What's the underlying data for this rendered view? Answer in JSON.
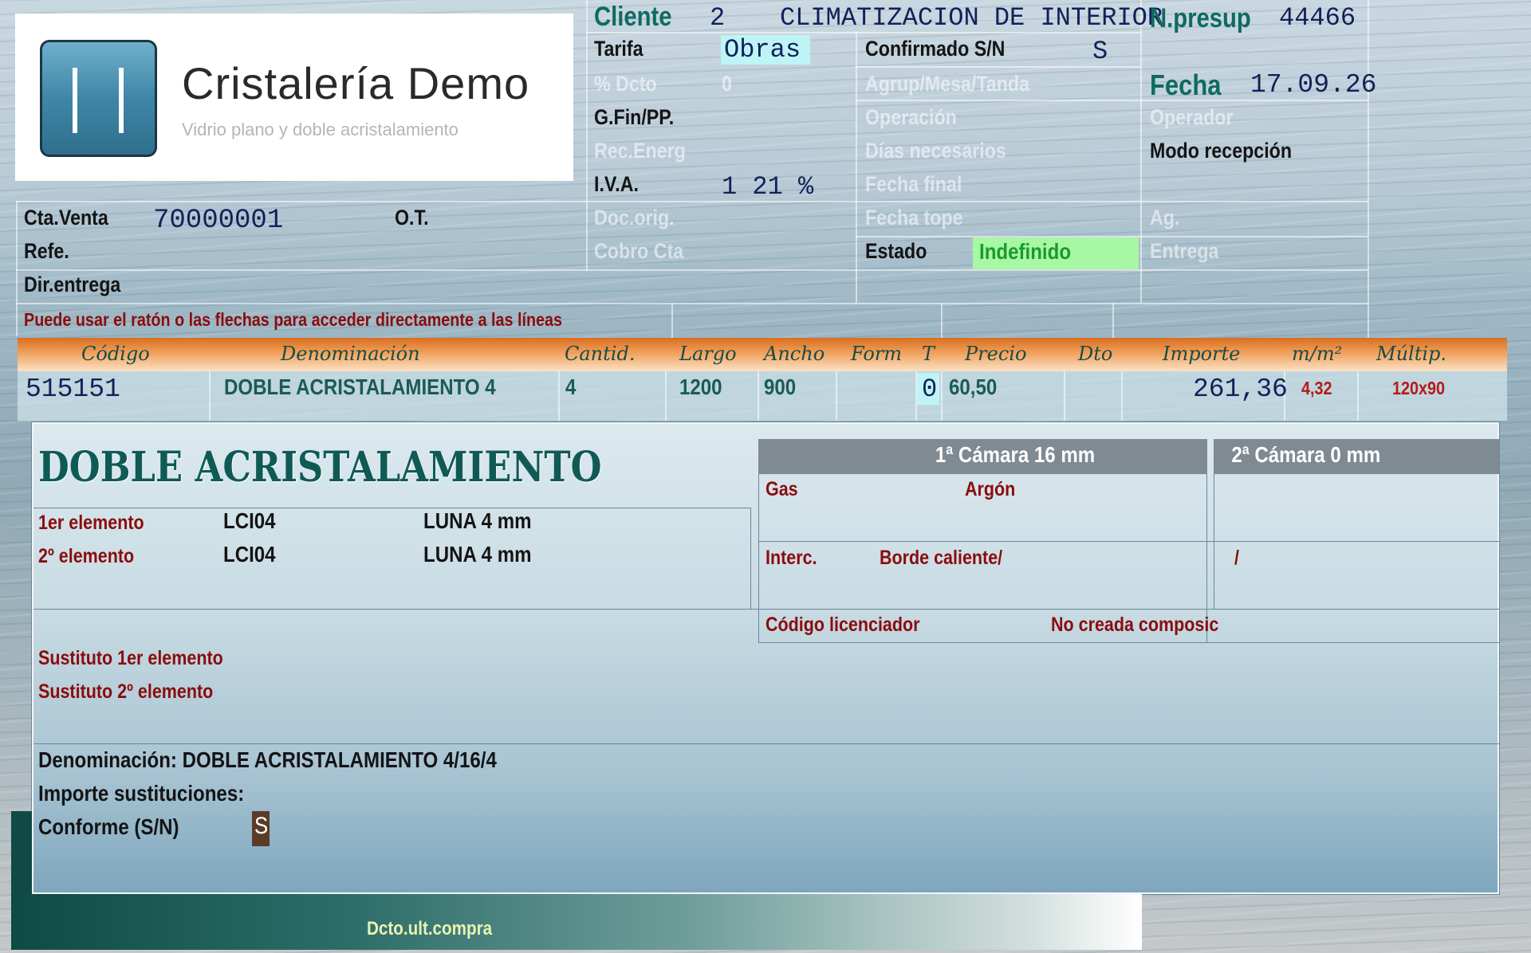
{
  "header": {
    "logo": {
      "title": "Cristalería Demo",
      "subtitle": "Vidrio plano y doble acristalamiento"
    },
    "cliente_label": "Cliente",
    "cliente_num": "2",
    "cliente_name": "CLIMATIZACION DE INTERIOR",
    "npresup_label": "N.presup",
    "npresup_value": "44466",
    "tarifa_label": "Tarifa",
    "tarifa_value": "Obras",
    "confirmado_label": "Confirmado S/N",
    "confirmado_value": "S",
    "dcto_label": "% Dcto",
    "dcto_value": "0",
    "agrup_label": "Agrup/Mesa/Tanda",
    "fecha_label": "Fecha",
    "fecha_value": "17.09.26",
    "gfin_label": "G.Fin/PP.",
    "operacion_label": "Operación",
    "operador_label": "Operador",
    "recenerg_label": "Rec.Energ",
    "dias_label": "Días necesarios",
    "modo_label": "Modo recepción",
    "iva_label": "I.V.A.",
    "iva_value": "1 21 %",
    "fechafinal_label": "Fecha final",
    "ctaventa_label": "Cta.Venta",
    "ctaventa_value": "70000001",
    "ot_label": "O.T.",
    "docorig_label": "Doc.orig.",
    "fechatope_label": "Fecha tope",
    "ag_label": "Ag.",
    "refe_label": "Refe.",
    "cobro_label": "Cobro Cta",
    "estado_label": "Estado",
    "estado_value": "Indefinido",
    "entrega_label": "Entrega",
    "direntrega_label": "Dir.entrega",
    "hint": "Puede usar el ratón o las flechas para acceder directamente a las líneas"
  },
  "columns": [
    "Código",
    "Denominación",
    "Cantid.",
    "Largo",
    "Ancho",
    "Form",
    "T",
    "Precio",
    "Dto",
    "Importe",
    "m/m²",
    "Múltip."
  ],
  "line": {
    "codigo": "515151",
    "denominacion": "DOBLE ACRISTALAMIENTO 4",
    "cantidad": "4",
    "largo": "1200",
    "ancho": "900",
    "form": "",
    "t": "0",
    "precio": "60,50",
    "dto": "",
    "importe": "261,36",
    "m2": "4,32",
    "multip": "120x90"
  },
  "panel": {
    "title": "DOBLE ACRISTALAMIENTO",
    "elem1_label": "1er elemento",
    "elem1_code": "LCI04",
    "elem1_desc": "LUNA 4 mm",
    "elem2_label": "2º  elemento",
    "elem2_code": "LCI04",
    "elem2_desc": "LUNA 4 mm",
    "cam1_title": "1ª Cámara 16 mm",
    "cam2_title": "2ª Cámara 0 mm",
    "gas_label": "Gas",
    "gas_value": "Argón",
    "interc_label": "Interc.",
    "interc_value": "Borde caliente/",
    "interc2_value": "/",
    "codlic_label": "Código licenciador",
    "codlic_value": "No creada composic",
    "sust1_label": "Sustituto 1er elemento",
    "sust2_label": "Sustituto 2º  elemento",
    "denominacion": "Denominación: DOBLE ACRISTALAMIENTO 4/16/4",
    "importe_sust_label": "Importe sustituciones:",
    "conforme_label": "Conforme (S/N)",
    "conforme_value": "S"
  },
  "footer": {
    "dcto_label": "Dcto.ult.compra"
  },
  "colors": {
    "accent_teal": "#0f6a62",
    "header_orange": "#e07a2c",
    "estado_green": "#a7f7a3",
    "dark_red": "#8a0d0d"
  }
}
